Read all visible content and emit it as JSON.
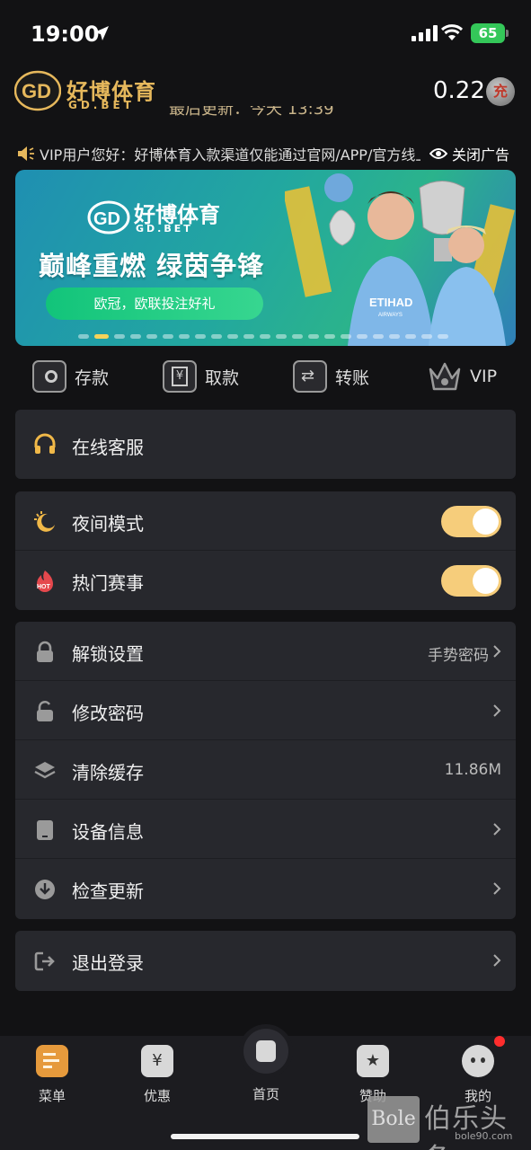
{
  "status_bar": {
    "time": "19:00",
    "battery": "65"
  },
  "header": {
    "brand_name": "好博体育",
    "brand_domain": "GD.BET",
    "logo_letters": "GD",
    "balance": "0.22",
    "recharge_label": "充"
  },
  "update_line": "最后更新：今天 13:39",
  "notice": {
    "text": "VIP用户您好：好博体育入款渠道仅能通过官网/APP/官方线上充值",
    "close_label": "关闭广告"
  },
  "banner": {
    "brand_name": "好博体育",
    "brand_domain": "GD.BET",
    "headline": "巅峰重燃 绿茵争锋",
    "pill_text": "欧冠，欧联投注好礼",
    "shirt_text": "ETIHAD",
    "shirt_sub": "AIRWAYS",
    "dot_count": 23,
    "active_dot": 1
  },
  "quick_actions": [
    {
      "label": "存款",
      "icon": "deposit-icon"
    },
    {
      "label": "取款",
      "icon": "withdraw-icon"
    },
    {
      "label": "转账",
      "icon": "transfer-icon"
    },
    {
      "label": "VIP",
      "icon": "crown-icon"
    }
  ],
  "support": {
    "label": "在线客服",
    "icon": "headset-icon"
  },
  "toggles": [
    {
      "label": "夜间模式",
      "icon": "night-mode-icon",
      "on": true
    },
    {
      "label": "热门赛事",
      "icon": "hot-icon",
      "on": true,
      "icon_text": "HOT"
    }
  ],
  "settings": [
    {
      "label": "解锁设置",
      "value": "手势密码",
      "icon": "lock-icon",
      "chevron": true
    },
    {
      "label": "修改密码",
      "value": "",
      "icon": "unlock-icon",
      "chevron": true
    },
    {
      "label": "清除缓存",
      "value": "11.86M",
      "icon": "layers-icon",
      "chevron": false
    },
    {
      "label": "设备信息",
      "value": "",
      "icon": "tablet-icon",
      "chevron": true
    },
    {
      "label": "检查更新",
      "value": "",
      "icon": "download-icon",
      "chevron": true
    }
  ],
  "logout": {
    "label": "退出登录",
    "icon": "logout-icon"
  },
  "bottom_nav": [
    {
      "label": "菜单",
      "icon": "menu-icon",
      "active": true
    },
    {
      "label": "优惠",
      "icon": "promo-icon",
      "active": false
    },
    {
      "label": "首页",
      "icon": "home-icon",
      "active": false
    },
    {
      "label": "赞助",
      "icon": "sponsor-icon",
      "active": false
    },
    {
      "label": "我的",
      "icon": "profile-icon",
      "active": false
    }
  ],
  "watermark": {
    "box": "Bole",
    "text": "伯乐头条",
    "url": "bole90.com"
  },
  "colors": {
    "background": "#121214",
    "card": "#27282d",
    "gold": "#e6b85c",
    "toggle": "#f6cd7b",
    "battery": "#34c759"
  }
}
